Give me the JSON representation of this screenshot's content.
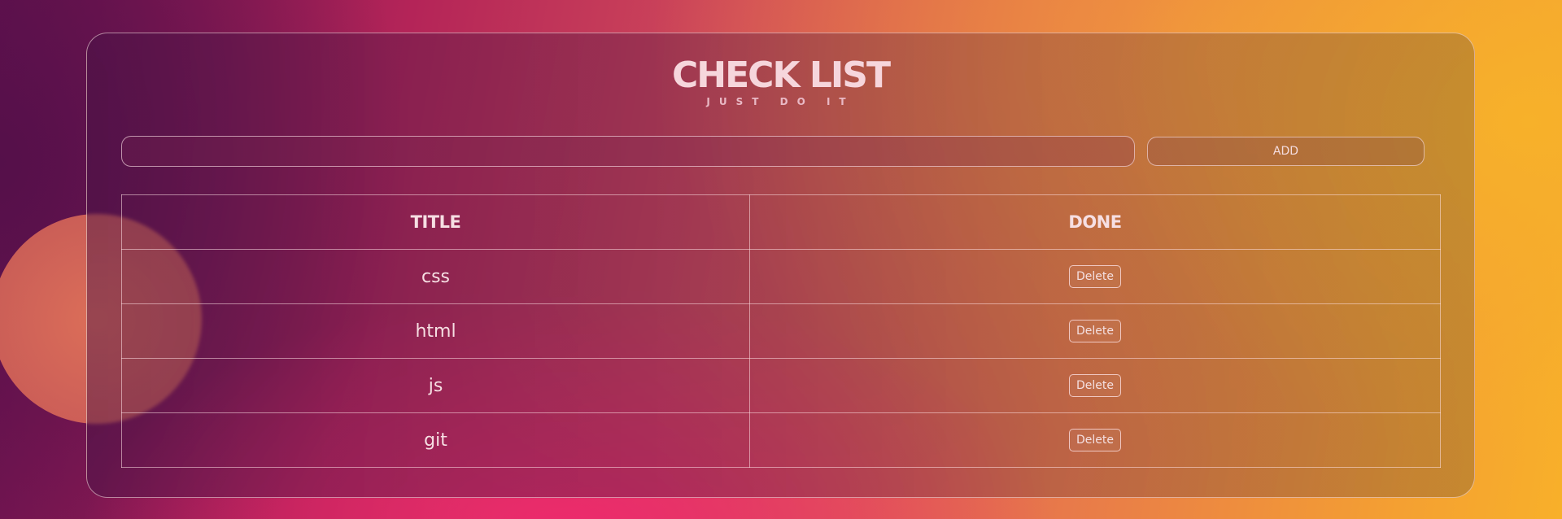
{
  "header": {
    "title": "CHECK LIST",
    "subtitle": "JUST DO IT"
  },
  "form": {
    "input_value": "",
    "input_placeholder": "",
    "add_label": "ADD"
  },
  "table": {
    "columns": [
      "TITLE",
      "DONE"
    ],
    "rows": [
      {
        "title": "css",
        "action": "Delete"
      },
      {
        "title": "html",
        "action": "Delete"
      },
      {
        "title": "js",
        "action": "Delete"
      },
      {
        "title": "git",
        "action": "Delete"
      }
    ]
  },
  "colors": {
    "text": "#f6dfe3",
    "border": "#f5dde2"
  }
}
